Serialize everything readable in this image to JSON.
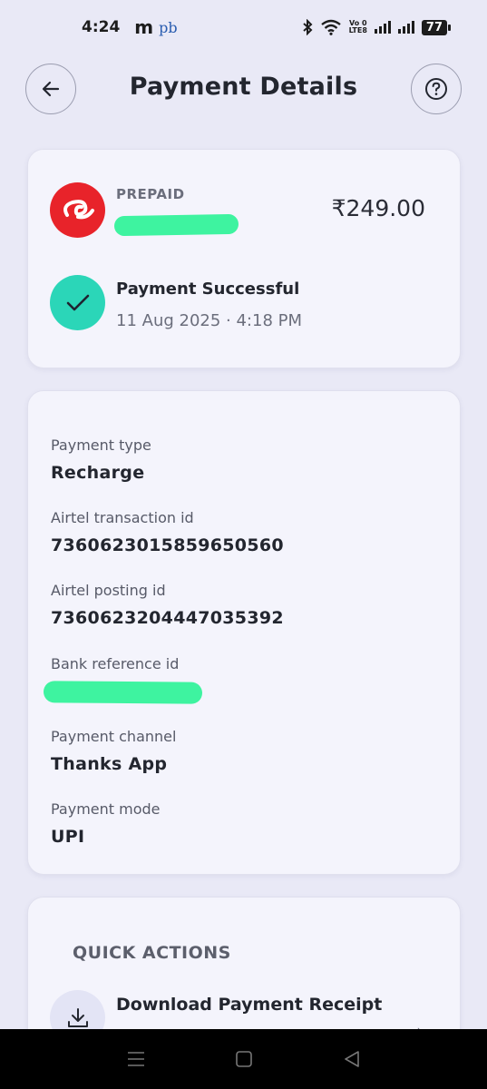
{
  "status_bar": {
    "time": "4:24",
    "app_icon_1": "m",
    "app_icon_2": "pb",
    "network_label_top": "Vo 0",
    "network_label_bottom": "LTE8",
    "battery": "77",
    "icons": [
      "bluetooth-icon",
      "wifi-icon",
      "signal-icon",
      "signal-icon",
      "battery-icon"
    ]
  },
  "header": {
    "title": "Payment Details",
    "back_icon": "arrow-left-icon",
    "help_icon": "question-icon"
  },
  "summary": {
    "plan_type": "PREPAID",
    "amount": "₹249.00",
    "logo_icon": "airtel-logo",
    "status_title": "Payment Successful",
    "status_date": "11 Aug 2025 · 4:18 PM",
    "status_icon": "check-icon"
  },
  "details": [
    {
      "label": "Payment type",
      "value": "Recharge"
    },
    {
      "label": "Airtel transaction id",
      "value": "7360623015859650560"
    },
    {
      "label": "Airtel posting id",
      "value": "7360623204447035392"
    },
    {
      "label": "Bank reference id",
      "value": ""
    },
    {
      "label": "Payment channel",
      "value": "Thanks App"
    },
    {
      "label": "Payment mode",
      "value": "UPI"
    }
  ],
  "quick_actions": {
    "title": "QUICK ACTIONS",
    "items": [
      {
        "label": "Download Payment Receipt",
        "icon": "download-icon"
      }
    ]
  },
  "colors": {
    "background": "#e9e9f6",
    "card": "#f4f4fc",
    "airtel_red": "#e8232a",
    "success_teal": "#2bd6b8",
    "redaction": "#3ef3a0"
  }
}
